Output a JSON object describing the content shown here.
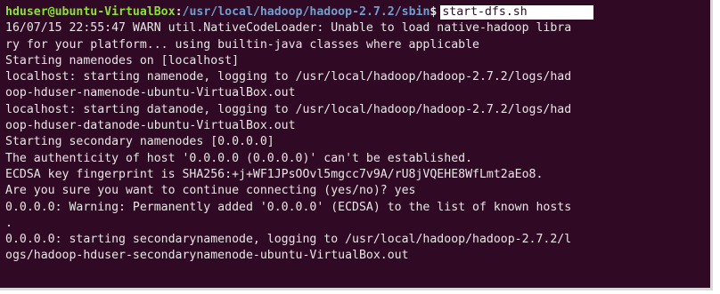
{
  "terminal": {
    "prompt": {
      "user_host": "hduser@ubuntu-VirtualBox",
      "separator": ":",
      "path": "/usr/local/hadoop/hadoop-2.7.2/sbin",
      "symbol": "$",
      "command": "start-dfs.sh"
    },
    "lines": [
      "16/07/15 22:55:47 WARN util.NativeCodeLoader: Unable to load native-hadoop libra",
      "ry for your platform... using builtin-java classes where applicable",
      "Starting namenodes on [localhost]",
      "localhost: starting namenode, logging to /usr/local/hadoop/hadoop-2.7.2/logs/had",
      "oop-hduser-namenode-ubuntu-VirtualBox.out",
      "localhost: starting datanode, logging to /usr/local/hadoop/hadoop-2.7.2/logs/had",
      "oop-hduser-datanode-ubuntu-VirtualBox.out",
      "Starting secondary namenodes [0.0.0.0]",
      "The authenticity of host '0.0.0.0 (0.0.0.0)' can't be established.",
      "ECDSA key fingerprint is SHA256:+j+WF1JPsOOvl5mgcc7v9A/rU8jVQEHE8WfLmt2aEo8.",
      "Are you sure you want to continue connecting (yes/no)? yes",
      "0.0.0.0: Warning: Permanently added '0.0.0.0' (ECDSA) to the list of known hosts",
      ".",
      "0.0.0.0: starting secondarynamenode, logging to /usr/local/hadoop/hadoop-2.7.2/l",
      "ogs/hadoop-hduser-secondarynamenode-ubuntu-VirtualBox.out"
    ]
  },
  "colors": {
    "background": "#300a24",
    "prompt_user": "#8ae234",
    "prompt_path": "#729fcf",
    "text": "#e6e6e6"
  }
}
